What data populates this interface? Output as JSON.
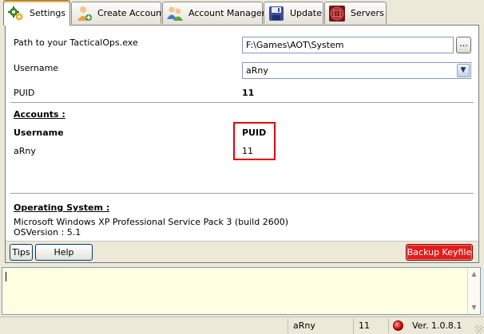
{
  "tabs": [
    {
      "label": "Settings",
      "icon": "settings-icon",
      "active": true
    },
    {
      "label": "Create Account",
      "icon": "user-add-icon",
      "active": false
    },
    {
      "label": "Account Manager",
      "icon": "users-icon",
      "active": false
    },
    {
      "label": "Update",
      "icon": "floppy-disk-icon",
      "active": false
    },
    {
      "label": "Servers",
      "icon": "server-icon",
      "active": false
    }
  ],
  "settings": {
    "path_label": "Path to your TacticalOps.exe",
    "path_value": "F:\\Games\\AOT\\System",
    "browse_label": "...",
    "username_label": "Username",
    "username_value": "aRny",
    "puid_label": "PUID",
    "puid_value": "11"
  },
  "accounts": {
    "heading": "Accounts :",
    "col_username": "Username",
    "col_puid": "PUID",
    "rows": [
      {
        "username": "aRny",
        "puid": "11"
      }
    ]
  },
  "os": {
    "heading": "Operating System :",
    "name": "Microsoft Windows XP Professional Service Pack 3 (build 2600)",
    "version": "OSVersion : 5.1"
  },
  "buttons": {
    "tips": "Tips",
    "help": "Help",
    "backup": "Backup Keyfile"
  },
  "log": {
    "text": ""
  },
  "status": {
    "username": "aRny",
    "puid": "11",
    "connection_icon": "status-led-icon",
    "connection_color": "#d10000",
    "version": "Ver. 1.0.8.1"
  },
  "colors": {
    "highlight": "#e00000",
    "backup_button": "#e21d1d",
    "log_background": "#ffffe1"
  }
}
